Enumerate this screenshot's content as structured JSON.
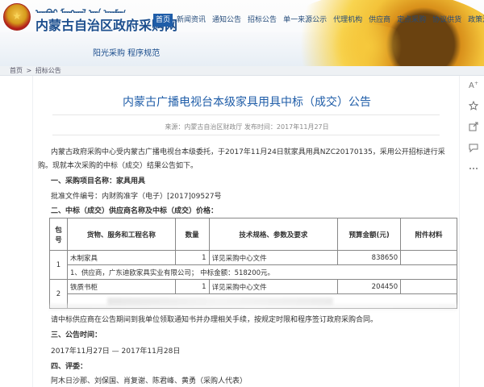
{
  "header": {
    "mongolian_title": "ᠥᠪᠦᠷ ᠮᠣᠩᠭᠣᠯ ᠤᠨ ᠠᠶᠢᠮᠠᠭ",
    "site_title": "内蒙古自治区政府采购网",
    "slogan": "阳光采购    程序规范"
  },
  "nav": {
    "items": [
      "首页",
      "新闻资讯",
      "通知公告",
      "招标公告",
      "单一来源公示",
      "代理机构",
      "供应商",
      "定点采购",
      "协议供货",
      "政策法规"
    ],
    "active_index": 0
  },
  "breadcrumb": {
    "home": "首页",
    "sep": ">",
    "current": "招标公告"
  },
  "article": {
    "title": "内蒙古广播电视台本级家具用具中标（成交）公告",
    "meta": "来源：内蒙古自治区财政厅     发布时间：2017年11月27日",
    "intro_line1": "内蒙古政府采购中心受内蒙古广播电视台本级委托，于2017年11月24日就家具用具NZC20170135，采用公开招标进行采",
    "intro_line2": "购。现就本次采购的中标（成交）结果公告如下。",
    "section1": "一、采购项目名称：家具用具",
    "approval": "批准文件编号：内财购准字（电子）[2017]09527号",
    "section2": "二、中标（成交）供应商名称及中标（成交）价格：",
    "notice_after_table": "请中标供应商在公告期间到我单位领取通知书并办理相关手续，按规定时限和程序签订政府采购合同。",
    "section3": "三、公告时间：",
    "announcement_period": "2017年11月27日    —    2017年11月28日",
    "section4": "四、评委：",
    "reviewers": "阿木日沙那、刘保国、肖复谢、陈君峰、黄勇（采购人代表）"
  },
  "table": {
    "headers": [
      "包号",
      "货物、服务和工程名称",
      "数量",
      "技术规格、参数及要求",
      "预算金额(元)",
      "附件材料"
    ],
    "packages": [
      {
        "no": "1",
        "name": "木制家具",
        "qty": "1",
        "spec": "详见采购中心文件",
        "budget": "838650",
        "supplier_line": "1、供应商，广东迪欧家具实业有限公司；  中标金额：518200元。"
      },
      {
        "no": "2",
        "name": "铁质书柜",
        "qty": "1",
        "spec": "详见采购中心文件",
        "budget": "204450",
        "supplier_line": ""
      }
    ]
  },
  "sidebar": {
    "icons": [
      "font-size-icon",
      "star-icon",
      "share-icon",
      "chat-icon",
      "more-icon"
    ]
  }
}
